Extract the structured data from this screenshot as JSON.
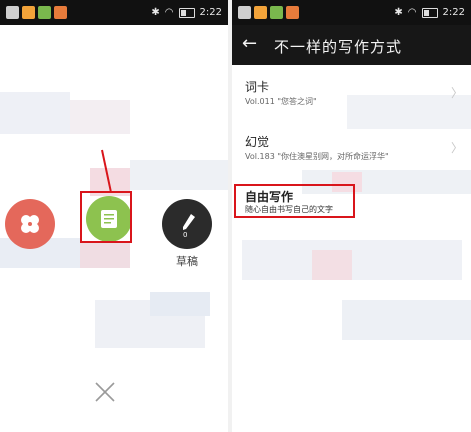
{
  "left_screen": {
    "status_bar": {
      "time": "2:22"
    },
    "draft_button": {
      "label": "草稿",
      "count": "0"
    }
  },
  "right_screen": {
    "status_bar": {
      "time": "2:22"
    },
    "toolbar": {
      "title": "不一样的写作方式"
    },
    "items": [
      {
        "title": "词卡",
        "subtitle": "Vol.011 \"您答之词\""
      },
      {
        "title": "幻觉",
        "subtitle": "Vol.183 \"你住澳星别网，对所命运浮华\""
      },
      {
        "title": "自由写作",
        "subtitle": "随心自由书写自己的文字"
      }
    ]
  },
  "colors": {
    "accent_red": "#d9151b",
    "clover_button": "#e4685b",
    "note_button": "#8dc24f",
    "draft_button": "#2b2b2b",
    "toolbar": "#171717"
  }
}
